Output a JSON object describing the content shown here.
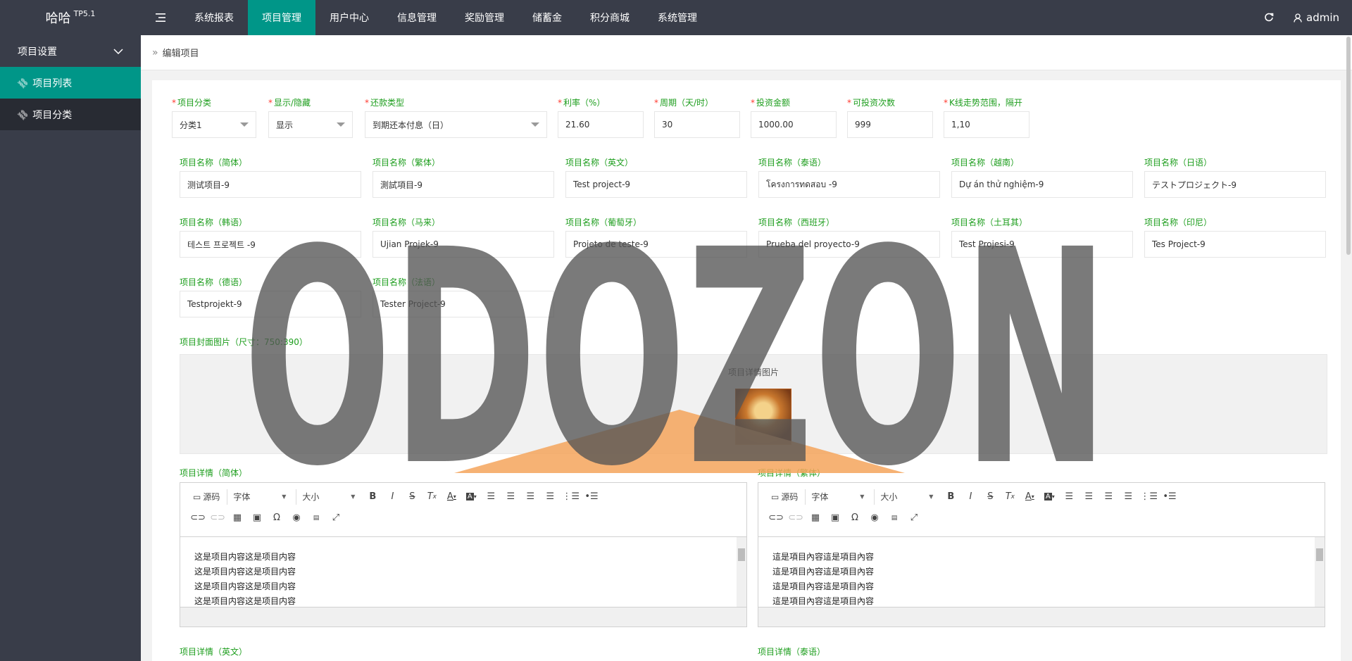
{
  "app": {
    "brand": "哈哈",
    "version": "TP5.1",
    "user": "admin"
  },
  "top_nav": [
    "系统报表",
    "项目管理",
    "用户中心",
    "信息管理",
    "奖励管理",
    "储蓄金",
    "积分商城",
    "系统管理"
  ],
  "top_nav_active": "项目管理",
  "sidebar": {
    "group": "项目设置",
    "items": [
      {
        "label": "项目列表",
        "active": true
      },
      {
        "label": "项目分类",
        "active": false
      }
    ]
  },
  "breadcrumb": "编辑项目",
  "form": {
    "category": {
      "label": "项目分类",
      "value": "分类1"
    },
    "visibility": {
      "label": "显示/隐藏",
      "value": "显示"
    },
    "repay_type": {
      "label": "还款类型",
      "value": "到期还本付息（日）"
    },
    "rate": {
      "label": "利率（%）",
      "value": "21.60"
    },
    "period": {
      "label": "周期（天/时）",
      "value": "30"
    },
    "amount": {
      "label": "投资金额",
      "value": "1000.00"
    },
    "times": {
      "label": "可投资次数",
      "value": "999"
    },
    "kline": {
      "label": "K线走势范围，隔开",
      "value": "1,10"
    },
    "names": [
      {
        "label": "项目名称（简体）",
        "value": "测试项目-9"
      },
      {
        "label": "项目名称（繁体）",
        "value": "測試項目-9"
      },
      {
        "label": "项目名称（英文）",
        "value": "Test project-9"
      },
      {
        "label": "项目名称（泰语）",
        "value": "โครงการทดสอบ -9"
      },
      {
        "label": "项目名称（越南）",
        "value": "Dự án thử nghiệm-9"
      },
      {
        "label": "项目名称（日语）",
        "value": "テストプロジェクト-9"
      },
      {
        "label": "项目名称（韩语）",
        "value": "테스트 프로젝트 -9"
      },
      {
        "label": "项目名称（马来）",
        "value": "Ujian Projek-9"
      },
      {
        "label": "项目名称（葡萄牙）",
        "value": "Projeto de teste-9"
      },
      {
        "label": "项目名称（西班牙）",
        "value": "Prueba del proyecto-9"
      },
      {
        "label": "项目名称（土耳其）",
        "value": "Test Projesi-9"
      },
      {
        "label": "项目名称（印尼）",
        "value": "Tes Project-9"
      },
      {
        "label": "项目名称（德语）",
        "value": "Testprojekt-9"
      },
      {
        "label": "项目名称（法语）",
        "value": "Tester Project-9"
      }
    ],
    "cover_label": "项目封面图片（尺寸：750:390）",
    "cover_caption": "项目详情图片",
    "details": [
      {
        "label": "项目详情（简体）",
        "lines": [
          "这是项目内容这是项目内容",
          "这是项目内容这是项目内容",
          "这是项目内容这是项目内容",
          "这是项目内容这是项目内容"
        ]
      },
      {
        "label": "项目详情（繁体）",
        "lines": [
          "這是項目內容這是項目內容",
          "這是項目內容這是項目內容",
          "這是項目內容這是項目內容",
          "這是項目內容這是項目內容"
        ]
      }
    ],
    "more_labels": [
      "项目详情（英文）",
      "项目详情（泰语）"
    ]
  },
  "editor_toolbar": {
    "source": "源码",
    "font": "字体",
    "size": "大小"
  },
  "watermark": "ODOZON",
  "colors": {
    "topbar": "#393d49",
    "accent": "#009688",
    "label_green": "#1e9e1e",
    "required": "#ff3b30",
    "watermark": "#555555",
    "watermark_roof": "#f4a45c"
  }
}
